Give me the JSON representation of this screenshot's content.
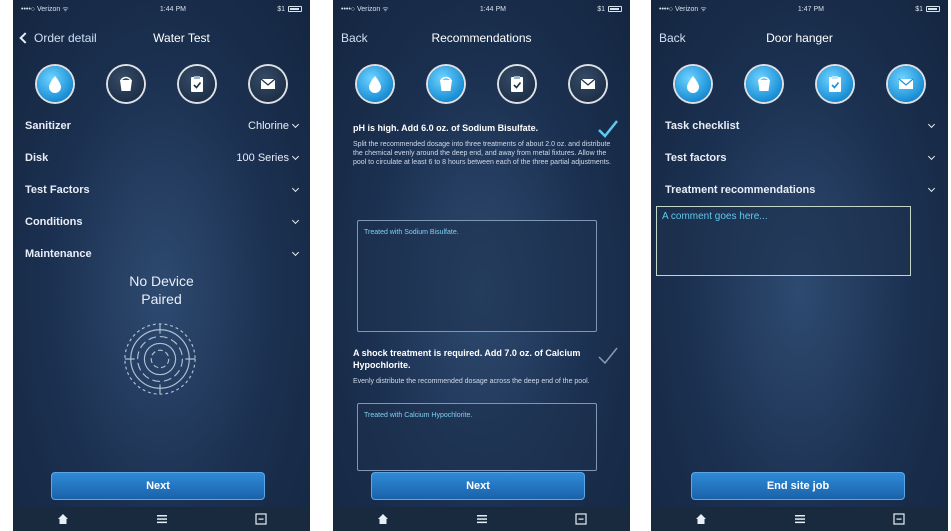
{
  "screen1": {
    "status": {
      "carrier": "••••○ Verizon ᯤ",
      "time": "1:44 PM",
      "battery": "$1"
    },
    "nav": {
      "back_label": "Order detail",
      "title": "Water Test"
    },
    "form_rows": [
      {
        "label": "Sanitizer",
        "value": "Chlorine"
      },
      {
        "label": "Disk",
        "value": "100 Series"
      },
      {
        "label": "Test Factors",
        "value": ""
      },
      {
        "label": "Conditions",
        "value": ""
      },
      {
        "label": "Maintenance",
        "value": ""
      }
    ],
    "device_status_line1": "No Device",
    "device_status_line2": "Paired",
    "primary_button": "Next"
  },
  "screen2": {
    "status": {
      "carrier": "••••○ Verizon ᯤ",
      "time": "1:44 PM",
      "battery": "$1"
    },
    "nav": {
      "back_label": "Back",
      "title": "Recommendations"
    },
    "recommendations": [
      {
        "heading": "pH is high. Add 6.0 oz. of Sodium Bisulfate.",
        "text": "Split the recommended dosage into three treatments of about 2.0 oz. and distribute the chemical evenly around the deep end, and away from metal fixtures. Allow the pool to circulate at least 6 to 8 hours between each of the three partial adjustments.",
        "note": "Treated with Sodium Bisulfate."
      },
      {
        "heading": "A shock treatment is required. Add 7.0 oz. of Calcium Hypochlorite.",
        "text": "Evenly distribute the recommended dosage across the deep end of the pool.",
        "note": "Treated with Calcium Hypochlorite."
      }
    ],
    "primary_button": "Next"
  },
  "screen3": {
    "status": {
      "carrier": "••••○ Verizon ᯤ",
      "time": "1:47 PM",
      "battery": "$1"
    },
    "nav": {
      "back_label": "Back",
      "title": "Door hanger"
    },
    "sections": [
      "Task checklist",
      "Test factors",
      "Treatment recommendations"
    ],
    "comment_placeholder": "A comment goes here...",
    "primary_button": "End site job"
  },
  "colors": {
    "accent": "#1a8fd6",
    "background": "#1b3050",
    "button": "#2a7fcf"
  },
  "icons": {
    "step_icons": [
      "water-drop-icon",
      "bucket-icon",
      "clipboard-check-icon",
      "envelope-icon"
    ],
    "tab_icons": [
      "home-icon",
      "menu-icon",
      "minimize-icon"
    ]
  }
}
